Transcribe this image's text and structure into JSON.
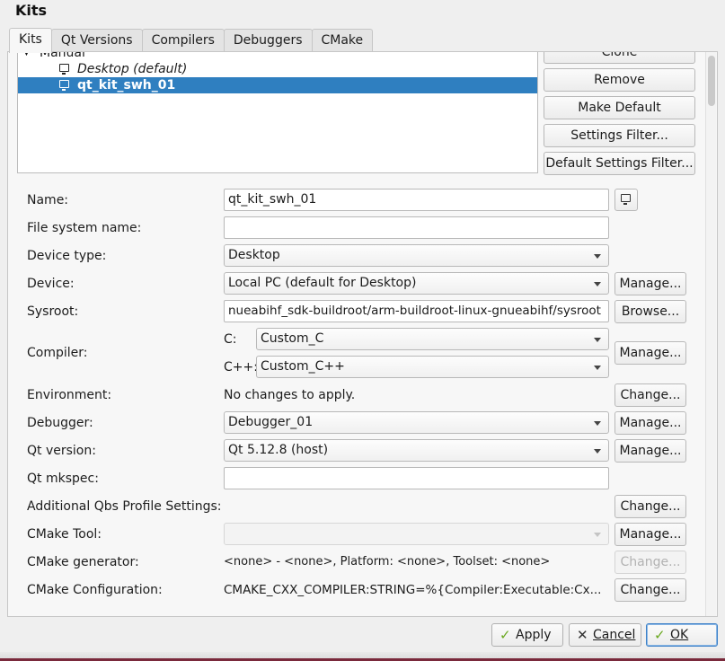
{
  "window": {
    "title": "Kits"
  },
  "tabs": [
    {
      "label": "Kits",
      "active": true
    },
    {
      "label": "Qt Versions",
      "active": false
    },
    {
      "label": "Compilers",
      "active": false
    },
    {
      "label": "Debuggers",
      "active": false
    },
    {
      "label": "CMake",
      "active": false
    }
  ],
  "kit_tree": {
    "group_label": "Manual",
    "items": [
      {
        "label": "Desktop (default)",
        "italic": true,
        "selected": false
      },
      {
        "label": "qt_kit_swh_01",
        "italic": false,
        "selected": true
      }
    ]
  },
  "kit_buttons": {
    "clone": "Clone",
    "remove": "Remove",
    "make_default": "Make Default",
    "settings_filter": "Settings Filter...",
    "default_settings_filter": "Default Settings Filter..."
  },
  "form": {
    "name": {
      "label": "Name:",
      "value": "qt_kit_swh_01"
    },
    "file_system_name": {
      "label": "File system name:",
      "value": ""
    },
    "device_type": {
      "label": "Device type:",
      "value": "Desktop"
    },
    "device": {
      "label": "Device:",
      "value": "Local PC (default for Desktop)",
      "button": "Manage..."
    },
    "sysroot": {
      "label": "Sysroot:",
      "value": "nueabihf_sdk-buildroot/arm-buildroot-linux-gnueabihf/sysroot",
      "button": "Browse..."
    },
    "compiler": {
      "label": "Compiler:",
      "c_label": "C:",
      "c_value": "Custom_C",
      "cxx_label": "C++:",
      "cxx_value": "Custom_C++",
      "button": "Manage..."
    },
    "environment": {
      "label": "Environment:",
      "value": "No changes to apply.",
      "button": "Change..."
    },
    "debugger": {
      "label": "Debugger:",
      "value": "Debugger_01",
      "button": "Manage..."
    },
    "qt_version": {
      "label": "Qt version:",
      "value": "Qt 5.12.8 (host)",
      "button": "Manage..."
    },
    "qt_mkspec": {
      "label": "Qt mkspec:",
      "value": ""
    },
    "qbs_profile": {
      "label": "Additional Qbs Profile Settings:",
      "button": "Change..."
    },
    "cmake_tool": {
      "label": "CMake Tool:",
      "value": "",
      "button": "Manage..."
    },
    "cmake_generator": {
      "label": "CMake generator:",
      "value": "<none> - <none>, Platform: <none>, Toolset: <none>",
      "button": "Change..."
    },
    "cmake_configuration": {
      "label": "CMake Configuration:",
      "value": "CMAKE_CXX_COMPILER:STRING=%{Compiler:Executable:Cx...",
      "button": "Change..."
    }
  },
  "annotation": {
    "line1": "",
    "line2": "",
    "color": "#e02020"
  },
  "dialog_buttons": {
    "apply": "Apply",
    "cancel": "Cancel",
    "ok": "OK"
  },
  "icons": {
    "device_picker": "monitor-icon",
    "apply": "checkmark-icon",
    "cancel": "cross-icon",
    "ok": "checkmark-icon"
  }
}
